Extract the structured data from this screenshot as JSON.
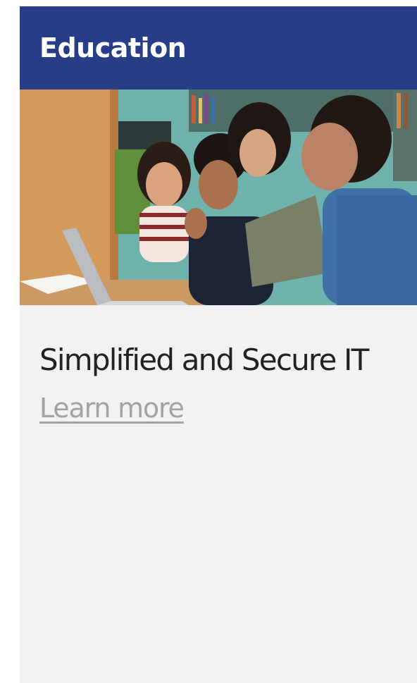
{
  "card": {
    "category": "Education",
    "headline": "Simplified and Secure IT",
    "link_label": "Learn more",
    "photo_description": "Students gathered around a laptop in a library"
  },
  "colors": {
    "header_bg": "#283d87",
    "card_bg": "#f2f2f2",
    "link": "#a3a3a3"
  }
}
